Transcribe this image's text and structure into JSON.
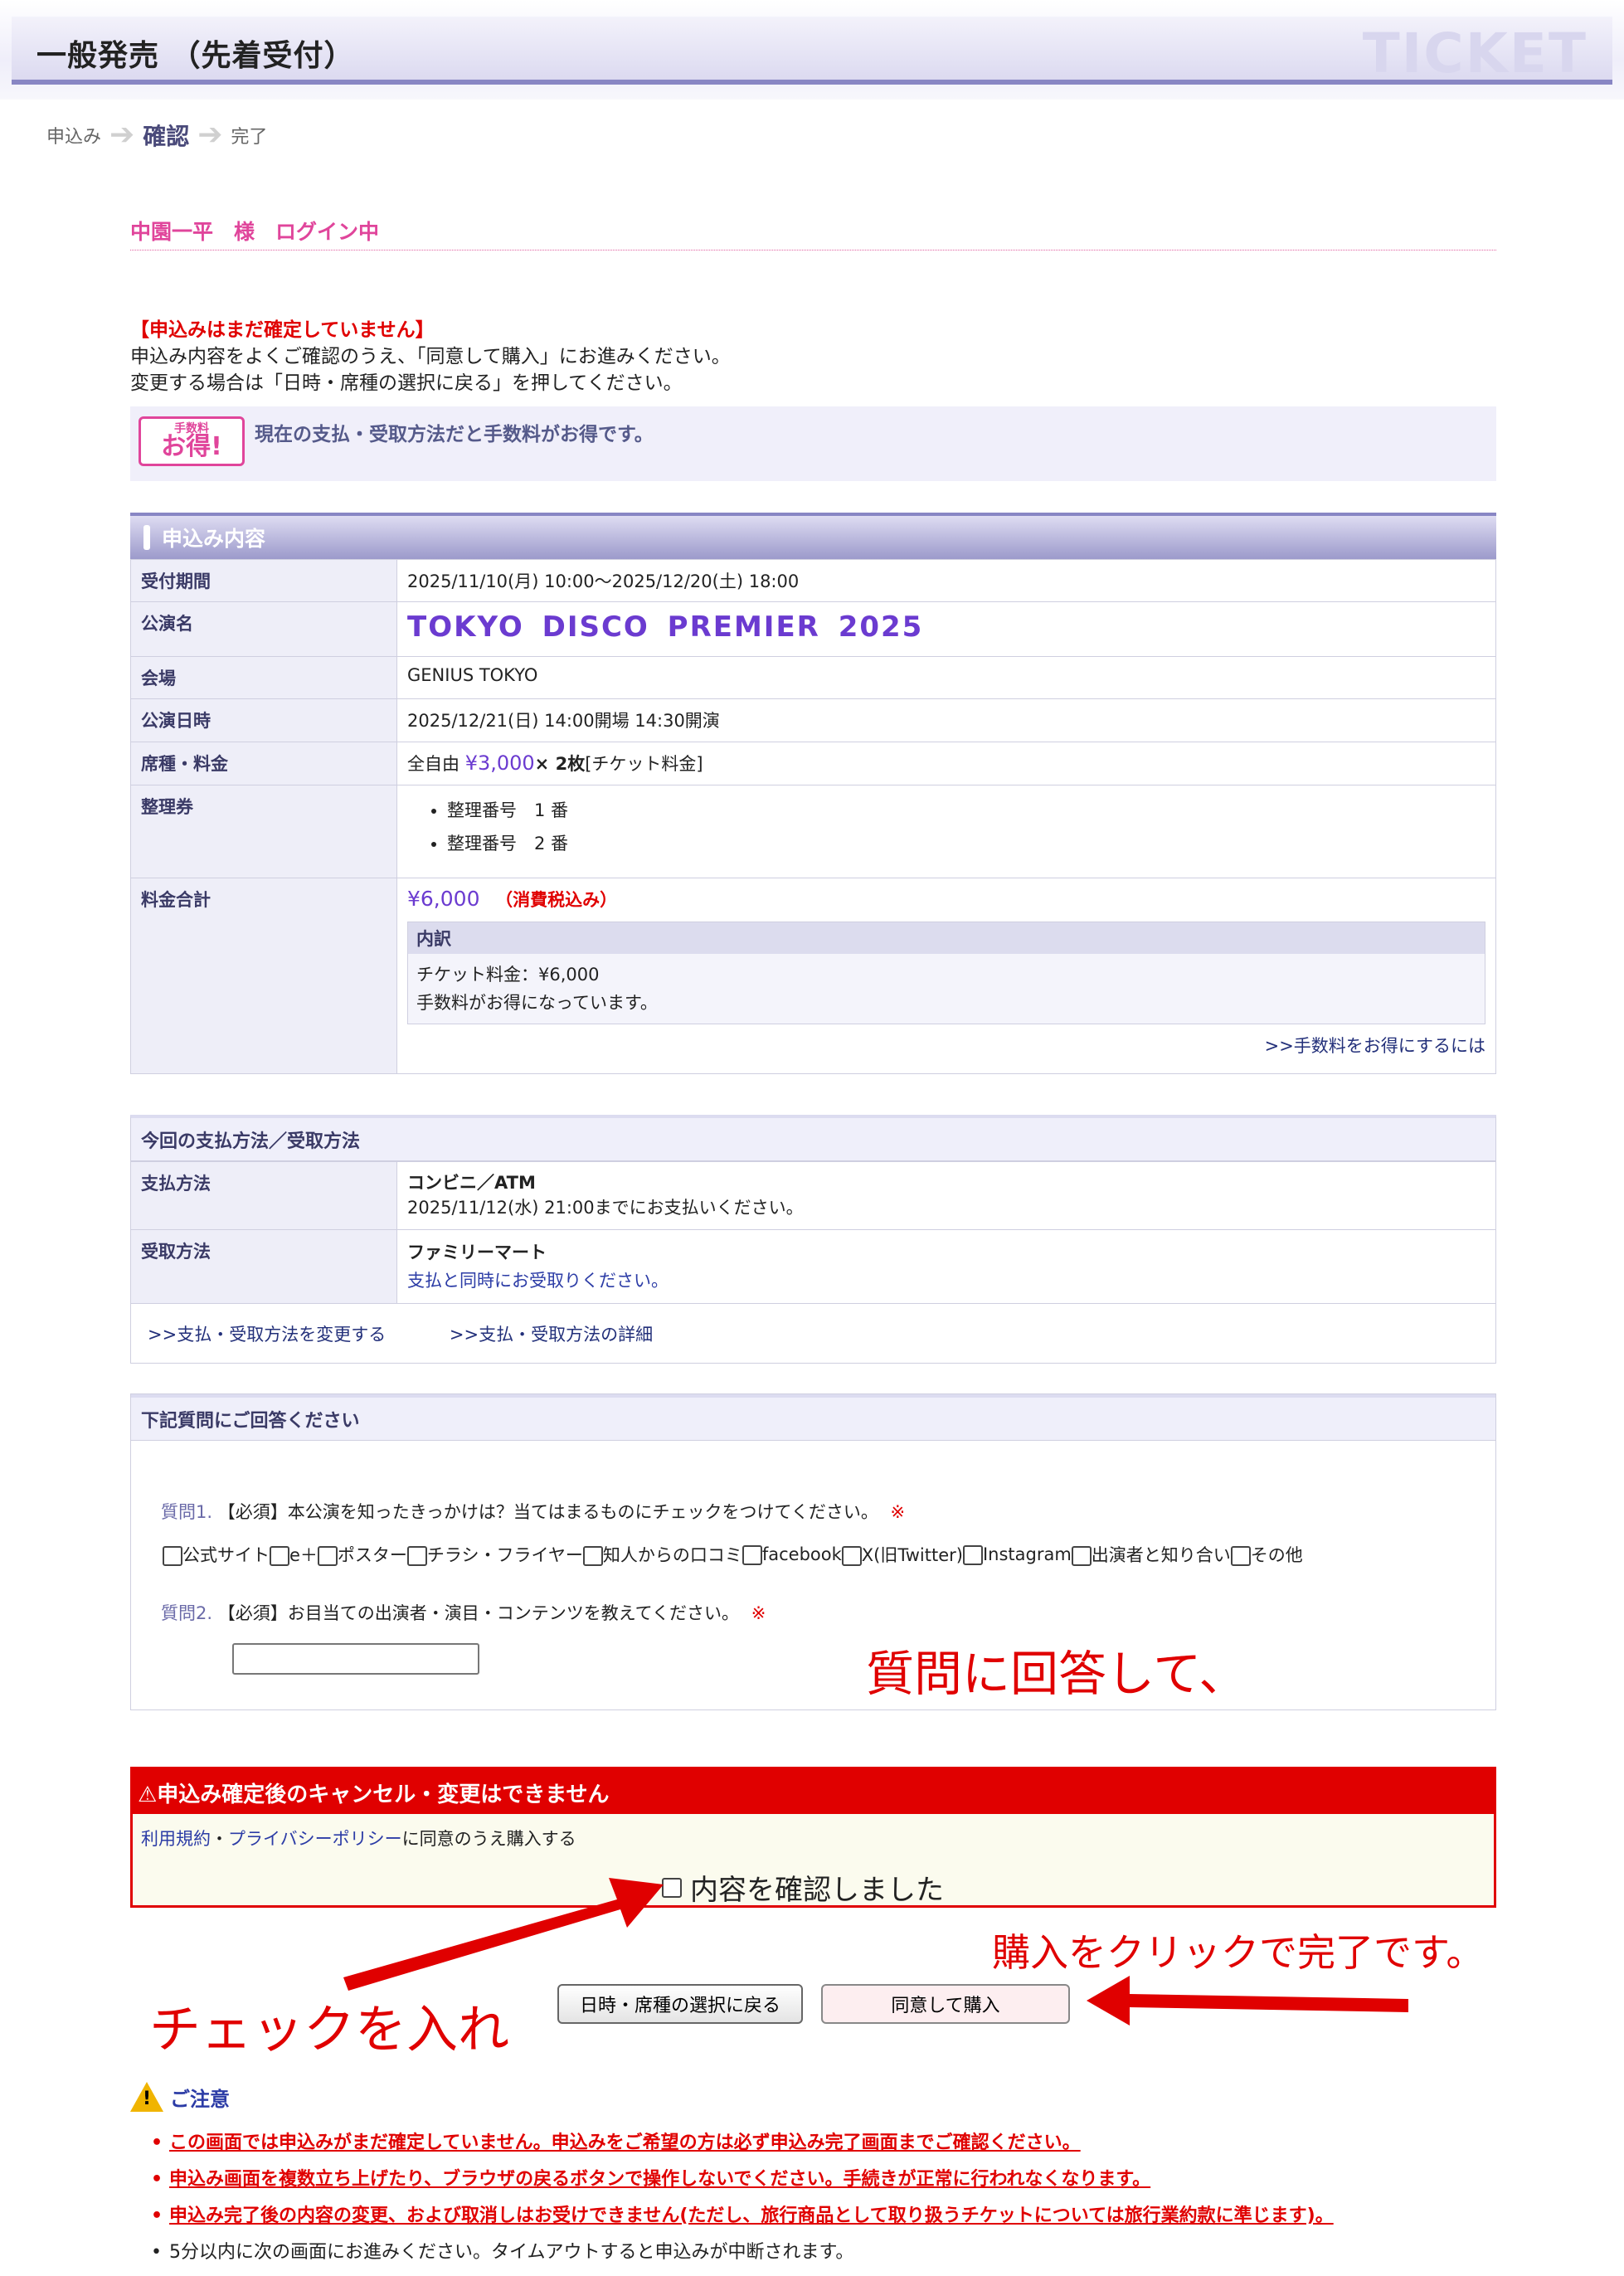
{
  "header": {
    "title": "一般発売 （先着受付）",
    "wordmark": "TICKET"
  },
  "steps": [
    "申込み",
    "確認",
    "完了"
  ],
  "login": "中園一平　様　ログイン中",
  "notice": {
    "warning": "【申込みはまだ確定していません】",
    "line1": "申込み内容をよくご確認のうえ、「同意して購入」にお進みください。",
    "line2": "変更する場合は「日時・席種の選択に戻る」を押してください。"
  },
  "fee_banner": {
    "logo_small": "手数料",
    "logo_large": "お得!",
    "text": "現在の支払・受取方法だと手数料がお得です。"
  },
  "order": {
    "title": "申込み内容",
    "period_label": "受付期間",
    "period_value": "2025/11/10(月) 10:00〜2025/12/20(土) 18:00",
    "show_label": "公演名",
    "show_value": "TOKYO DISCO PREMIER 2025",
    "venue_label": "会場",
    "venue_value": "GENIUS TOKYO",
    "datetime_label": "公演日時",
    "datetime_value": "2025/12/21(日) 14:00開場 14:30開演",
    "seat_label": "席種・料金",
    "seat_prefix": "全自由",
    "seat_price": "¥3,000",
    "seat_qty": "× 2枚",
    "seat_suffix": "[チケット料金]",
    "ticket_no_label": "整理券",
    "ticket_numbers": [
      "整理番号　1 番",
      "整理番号　2 番"
    ],
    "total_label": "料金合計",
    "total_value": "¥6,000",
    "total_tax": "（消費税込み）",
    "breakdown_title": "内訳",
    "breakdown_line1": "チケット料金：¥6,000",
    "breakdown_line2": "手数料がお得になっています。",
    "fee_link": ">>手数料をお得にするには"
  },
  "payment": {
    "title": "今回の支払方法／受取方法",
    "pay_label": "支払方法",
    "pay_value": "コンビニ／ATM",
    "pay_note": "2025/11/12(水) 21:00までにお支払いください。",
    "receive_label": "受取方法",
    "receive_value": "ファミリーマート",
    "receive_note": "支払と同時にお受取りください。",
    "link_change": ">>支払・受取方法を変更する",
    "link_detail": ">>支払・受取方法の詳細"
  },
  "questions": {
    "title": "下記質問にご回答ください",
    "q1_no": "質問1.",
    "q1_text": "【必須】本公演を知ったきっかけは？当てはまるものにチェックをつけてください。",
    "required_mark": "※",
    "q1_options": [
      "公式サイト",
      "e＋",
      "ポスター",
      "チラシ・フライヤー",
      "知人からの口コミ",
      "facebook",
      "X(旧Twitter)",
      "Instagram",
      "出演者と知り合い",
      "その他"
    ],
    "q2_no": "質問2.",
    "q2_text": "【必須】お目当ての出演者・演目・コンテンツを教えてください。"
  },
  "confirm": {
    "warning": "⚠申込み確定後のキャンセル・変更はできません",
    "terms_link1": "利用規約",
    "terms_sep": "・",
    "terms_link2": "プライバシーポリシー",
    "terms_text": "に同意のうえ購入する",
    "checkbox_label": "内容を確認しました"
  },
  "buttons": {
    "back": "日時・席種の選択に戻る",
    "purchase": "同意して購入"
  },
  "annotations": {
    "answer": "質問に回答して、",
    "check": "チェックを入れ",
    "purchase": "購入をクリックで完了です。"
  },
  "caution": {
    "title": "ご注意",
    "items": [
      "この画面では申込みがまだ確定していません。申込みをご希望の方は必ず申込み完了画面までご確認ください。",
      "申込み画面を複数立ち上げたり、ブラウザの戻るボタンで操作しないでください。手続きが正常に行われなくなります。",
      "申込み完了後の内容の変更、および取消しはお受けできません(ただし、旅行商品として取り扱うチケットについては旅行業約款に準じます)。",
      "5分以内に次の画面にお進みください。タイムアウトすると申込みが中断されます。"
    ]
  },
  "colors": {
    "accent_red": "#e00000",
    "header_purple": "#8886c4",
    "link_blue": "#2c3ca6",
    "pink": "#e0459b"
  }
}
